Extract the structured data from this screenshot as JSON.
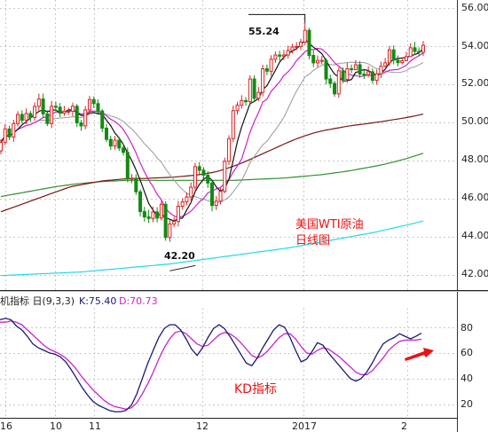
{
  "colors": {
    "up": "#dd2222",
    "down": "#138a13",
    "ma5": "#111111",
    "ma10": "#cc22cc",
    "ma20": "#999999",
    "ma60": "#7a1414",
    "ma120": "#2f8f2f",
    "ma250": "#22d8e8",
    "k": "#1a1a6e",
    "d": "#cc22cc",
    "annotation": "#ee1111",
    "arrow": "#ee1111",
    "grid": "#c8c8c8"
  },
  "chart_data": [
    {
      "type": "candlestick",
      "ylim": [
        41.3,
        56.6
      ],
      "grid": true,
      "y_ticks": [
        "56.00",
        "54.00",
        "52.00",
        "50.00",
        "48.00",
        "46.00",
        "44.00",
        "42.00"
      ],
      "x_ticks": [
        "16",
        "10",
        "11",
        "12",
        "2017",
        "2"
      ],
      "annotation": [
        "美国WTI原油",
        "日线图"
      ],
      "high_label": "55.24",
      "low_label": "42.20",
      "high_value": 55.24,
      "low_value": 42.2,
      "open": [
        48.5,
        48.95,
        49.65,
        49.23,
        49.93,
        50.41,
        50.1,
        50.46,
        50.25,
        50.83,
        51.22,
        50.44,
        49.93,
        50.84,
        50.79,
        50.48,
        50.58,
        50.58,
        50.84,
        49.97,
        49.81,
        50.65,
        51.19,
        50.98,
        50.59,
        49.69,
        49.1,
        48.75,
        49.06,
        48.65,
        48.42,
        47.02,
        47.06,
        46.35,
        45.31,
        45.03,
        44.95,
        45.29,
        44.97,
        45.69,
        43.95,
        44.66,
        44.79,
        45.59,
        45.82,
        46.08,
        46.59,
        47.67,
        47.48,
        47.22,
        46.81,
        45.63,
        45.86,
        46.37,
        47.95,
        49.14,
        50.61,
        50.9,
        51.14,
        51.08,
        52.27,
        51.26,
        51.57,
        52.81,
        52.68,
        53.31,
        53.53,
        53.47,
        53.53,
        53.77,
        53.95,
        53.98,
        54.21,
        54.83,
        53.51,
        53.12,
        53.24,
        53.25,
        52.27,
        52.04,
        51.49,
        52.7,
        52.25,
        52.81,
        52.76,
        53.02,
        52.53,
        52.5,
        52.65,
        52.2,
        52.54,
        52.94,
        53.12,
        53.8,
        53.26,
        53.13,
        53.23,
        53.45,
        53.91,
        53.72,
        53.68
      ],
      "close": [
        48.95,
        49.65,
        49.23,
        49.93,
        50.41,
        50.1,
        50.46,
        50.25,
        50.83,
        51.22,
        50.44,
        49.93,
        50.84,
        50.79,
        50.48,
        50.58,
        50.58,
        50.84,
        49.97,
        49.81,
        50.65,
        51.19,
        50.98,
        50.59,
        49.69,
        49.1,
        48.75,
        49.06,
        48.65,
        48.42,
        47.02,
        47.06,
        46.35,
        45.31,
        45.03,
        44.95,
        45.29,
        44.97,
        45.69,
        43.95,
        44.66,
        44.79,
        45.59,
        45.82,
        46.08,
        46.59,
        47.67,
        47.48,
        47.22,
        46.81,
        45.63,
        45.86,
        46.37,
        47.95,
        49.14,
        50.61,
        50.9,
        51.14,
        51.08,
        52.27,
        51.26,
        51.57,
        52.81,
        52.68,
        53.31,
        53.53,
        53.47,
        53.53,
        53.77,
        53.95,
        53.98,
        54.21,
        54.83,
        53.51,
        53.12,
        53.24,
        53.25,
        52.27,
        52.04,
        51.49,
        52.7,
        52.25,
        52.81,
        52.76,
        53.02,
        52.53,
        52.5,
        52.65,
        52.2,
        52.54,
        52.94,
        53.12,
        53.8,
        53.26,
        53.13,
        53.23,
        53.45,
        53.91,
        53.72,
        53.68,
        54.04
      ],
      "high": [
        49.12,
        49.9,
        49.82,
        50.13,
        50.58,
        50.63,
        50.72,
        50.6,
        51.04,
        51.5,
        51.51,
        50.63,
        51.12,
        51.09,
        51.01,
        50.86,
        50.77,
        51.03,
        50.96,
        50.13,
        50.85,
        51.38,
        51.36,
        51.2,
        50.69,
        49.9,
        49.3,
        49.28,
        49.23,
        48.89,
        48.67,
        47.28,
        47.26,
        46.48,
        45.56,
        45.41,
        45.57,
        45.54,
        45.88,
        45.85,
        44.88,
        45.02,
        45.87,
        46.01,
        46.32,
        46.84,
        47.87,
        47.91,
        47.64,
        47.43,
        46.97,
        46.13,
        46.54,
        48.14,
        49.32,
        50.87,
        51.08,
        51.42,
        51.32,
        52.47,
        52.47,
        51.85,
        53.02,
        53.03,
        53.52,
        53.72,
        53.75,
        53.8,
        54.02,
        54.12,
        54.21,
        54.38,
        55.24,
        54.95,
        53.77,
        53.51,
        53.48,
        53.36,
        52.5,
        52.18,
        52.89,
        52.88,
        53.12,
        53.03,
        53.27,
        53.21,
        52.76,
        52.95,
        52.83,
        52.77,
        53.18,
        53.38,
        54.01,
        54.04,
        53.51,
        53.4,
        53.7,
        54.15,
        54.22,
        53.93,
        54.27
      ],
      "low": [
        48.32,
        48.8,
        49.06,
        48.97,
        49.77,
        49.93,
        49.9,
        50.0,
        50.08,
        50.61,
        50.26,
        49.8,
        49.69,
        50.59,
        50.27,
        50.32,
        50.39,
        50.32,
        49.75,
        49.55,
        49.63,
        50.5,
        50.75,
        50.43,
        49.48,
        48.96,
        48.55,
        48.56,
        48.49,
        48.26,
        46.85,
        46.8,
        46.19,
        45.05,
        44.77,
        44.71,
        44.75,
        44.74,
        44.84,
        43.78,
        43.72,
        44.49,
        44.53,
        45.41,
        45.64,
        45.89,
        46.36,
        47.27,
        47.06,
        46.55,
        45.33,
        45.39,
        45.69,
        46.27,
        47.76,
        48.97,
        50.4,
        50.72,
        50.87,
        50.89,
        51.09,
        51.1,
        51.36,
        52.48,
        52.44,
        53.12,
        53.21,
        53.26,
        53.35,
        53.62,
        53.79,
        53.79,
        54.06,
        53.31,
        52.9,
        52.89,
        53.04,
        51.99,
        51.8,
        51.33,
        51.29,
        52.05,
        52.07,
        52.58,
        52.82,
        52.34,
        52.27,
        52.36,
        52.02,
        51.97,
        52.32,
        52.88,
        52.95,
        53.04,
        52.93,
        53.04,
        53.27,
        53.63,
        53.54,
        53.47,
        53.49
      ],
      "ma5": [
        48.95,
        49.3,
        49.28,
        49.44,
        49.63,
        49.86,
        50.03,
        50.23,
        50.41,
        50.57,
        50.66,
        50.54,
        50.65,
        50.64,
        50.5,
        50.52,
        50.65,
        50.65,
        50.49,
        50.36,
        50.37,
        50.49,
        50.52,
        50.44,
        50.42,
        50.11,
        49.82,
        49.44,
        49.17,
        48.84,
        48.38,
        47.98,
        47.5,
        46.95,
        46.35,
        45.74,
        45.39,
        45.11,
        45.19,
        44.97,
        44.91,
        44.81,
        44.94,
        44.97,
        45.39,
        45.78,
        46.36,
        46.73,
        47.01,
        47.15,
        46.96,
        46.6,
        46.38,
        46.52,
        47.0,
        47.99,
        49.0,
        49.75,
        50.38,
        50.98,
        51.09,
        51.26,
        51.71,
        51.92,
        52.33,
        52.72,
        53.16,
        53.41,
        53.61,
        53.73,
        53.86,
        54.06,
        54.33,
        54.15,
        53.94,
        53.79,
        53.59,
        53.25,
        52.85,
        52.53,
        52.37,
        52.17,
        52.18,
        52.24,
        52.61,
        52.69,
        52.77,
        52.71,
        52.58,
        52.45,
        52.56,
        52.79,
        53.12,
        53.3,
        53.35,
        53.38,
        53.39,
        53.49,
        53.55,
        53.64,
        53.89
      ],
      "ma10": [
        48.95,
        49.3,
        49.28,
        49.44,
        49.63,
        49.72,
        49.83,
        49.88,
        49.99,
        50.1,
        50.25,
        50.28,
        50.44,
        50.53,
        50.54,
        50.56,
        50.57,
        50.62,
        50.53,
        50.43,
        50.45,
        50.58,
        50.59,
        50.57,
        50.49,
        50.34,
        50.16,
        50.04,
        49.86,
        49.62,
        49.26,
        48.85,
        48.39,
        47.86,
        47.4,
        46.97,
        46.63,
        46.22,
        45.93,
        45.48,
        45.24,
        45.08,
        45.01,
        45.06,
        45.17,
        45.33,
        45.57,
        45.82,
        46.0,
        46.29,
        46.39,
        46.5,
        46.58,
        46.79,
        46.98,
        47.38,
        47.71,
        48.07,
        48.77,
        49.48,
        50.04,
        50.51,
        51.06,
        51.22,
        51.62,
        51.87,
        52.13,
        52.45,
        52.65,
        52.9,
        53.24,
        53.47,
        53.7,
        53.83,
        53.81,
        53.88,
        53.84,
        53.65,
        53.41,
        53.12,
        52.95,
        52.75,
        52.55,
        52.48,
        52.45,
        52.4,
        52.43,
        52.49,
        52.44,
        52.53,
        52.55,
        52.63,
        52.73,
        52.76,
        52.77,
        52.88,
        52.99,
        53.22,
        53.37,
        53.49,
        53.64
      ],
      "ma20": [
        48.95,
        49.3,
        49.28,
        49.44,
        49.63,
        49.72,
        49.83,
        49.88,
        49.99,
        50.1,
        50.11,
        50.09,
        50.15,
        50.2,
        50.22,
        50.24,
        50.26,
        50.29,
        50.27,
        50.25,
        50.33,
        50.4,
        50.47,
        50.51,
        50.48,
        50.42,
        50.33,
        50.27,
        50.17,
        50.04,
        49.83,
        49.64,
        49.41,
        49.14,
        48.87,
        48.64,
        48.41,
        48.13,
        47.9,
        47.55,
        47.25,
        46.96,
        46.7,
        46.46,
        46.28,
        46.15,
        46.1,
        46.02,
        45.96,
        45.89,
        45.82,
        45.79,
        45.8,
        45.93,
        46.07,
        46.35,
        46.64,
        46.95,
        47.39,
        47.88,
        48.21,
        48.51,
        48.82,
        49.0,
        49.31,
        49.6,
        49.92,
        50.26,
        50.72,
        51.19,
        51.64,
        52.0,
        52.38,
        52.52,
        52.72,
        52.87,
        52.99,
        53.05,
        53.03,
        53.01,
        53.1,
        53.11,
        53.13,
        53.16,
        53.13,
        53.14,
        53.13,
        53.07,
        52.92,
        52.82,
        52.75,
        52.69,
        52.64,
        52.62,
        52.61,
        52.64,
        52.71,
        52.86,
        52.91,
        53.01,
        53.14
      ],
      "ma60": [
        45.3,
        45.38,
        45.46,
        45.54,
        45.62,
        45.7,
        45.78,
        45.86,
        45.94,
        46.02,
        46.1,
        46.18,
        46.26,
        46.34,
        46.42,
        46.5,
        46.58,
        46.64,
        46.68,
        46.72,
        46.76,
        46.8,
        46.84,
        46.88,
        46.92,
        46.94,
        46.96,
        46.98,
        47.0,
        47.02,
        47.04,
        47.05,
        47.05,
        47.05,
        47.05,
        47.06,
        47.07,
        47.08,
        47.09,
        47.1,
        47.11,
        47.12,
        47.14,
        47.16,
        47.18,
        47.2,
        47.22,
        47.25,
        47.28,
        47.32,
        47.36,
        47.41,
        47.47,
        47.54,
        47.61,
        47.69,
        47.77,
        47.86,
        47.95,
        48.05,
        48.15,
        48.25,
        48.35,
        48.45,
        48.55,
        48.65,
        48.75,
        48.85,
        48.95,
        49.04,
        49.13,
        49.21,
        49.29,
        49.36,
        49.43,
        49.49,
        49.54,
        49.59,
        49.63,
        49.67,
        49.71,
        49.75,
        49.79,
        49.82,
        49.85,
        49.88,
        49.91,
        49.94,
        49.97,
        50.0,
        50.03,
        50.06,
        50.1,
        50.14,
        50.17,
        50.21,
        50.25,
        50.29,
        50.33,
        50.38,
        50.43
      ],
      "ma120": [
        46.1,
        46.14,
        46.18,
        46.22,
        46.26,
        46.3,
        46.34,
        46.38,
        46.42,
        46.46,
        46.5,
        46.54,
        46.58,
        46.62,
        46.65,
        46.68,
        46.71,
        46.74,
        46.77,
        46.79,
        46.81,
        46.83,
        46.85,
        46.87,
        46.89,
        46.9,
        46.91,
        46.92,
        46.93,
        46.94,
        46.95,
        46.95,
        46.95,
        46.95,
        46.95,
        46.95,
        46.95,
        46.95,
        46.95,
        46.95,
        46.95,
        46.95,
        46.95,
        46.95,
        46.95,
        46.95,
        46.95,
        46.95,
        46.95,
        46.95,
        46.95,
        46.95,
        46.95,
        46.95,
        46.95,
        46.95,
        46.96,
        46.97,
        46.98,
        46.99,
        47.0,
        47.01,
        47.02,
        47.03,
        47.04,
        47.05,
        47.06,
        47.07,
        47.09,
        47.11,
        47.13,
        47.15,
        47.17,
        47.19,
        47.21,
        47.23,
        47.25,
        47.28,
        47.31,
        47.34,
        47.37,
        47.4,
        47.43,
        47.47,
        47.51,
        47.55,
        47.59,
        47.63,
        47.67,
        47.71,
        47.76,
        47.81,
        47.86,
        47.91,
        47.97,
        48.03,
        48.09,
        48.16,
        48.23,
        48.3,
        48.37
      ],
      "ma250": [
        41.95,
        41.96,
        41.97,
        41.98,
        41.99,
        42.0,
        42.01,
        42.02,
        42.03,
        42.04,
        42.05,
        42.06,
        42.07,
        42.08,
        42.09,
        42.1,
        42.11,
        42.12,
        42.13,
        42.14,
        42.16,
        42.18,
        42.2,
        42.22,
        42.24,
        42.26,
        42.28,
        42.3,
        42.32,
        42.34,
        42.36,
        42.38,
        42.4,
        42.42,
        42.44,
        42.46,
        42.48,
        42.5,
        42.52,
        42.54,
        42.56,
        42.59,
        42.62,
        42.65,
        42.68,
        42.71,
        42.74,
        42.77,
        42.8,
        42.83,
        42.86,
        42.89,
        42.92,
        42.95,
        42.98,
        43.01,
        43.04,
        43.07,
        43.1,
        43.13,
        43.16,
        43.19,
        43.22,
        43.25,
        43.28,
        43.31,
        43.34,
        43.37,
        43.4,
        43.44,
        43.48,
        43.52,
        43.56,
        43.6,
        43.64,
        43.68,
        43.72,
        43.76,
        43.8,
        43.84,
        43.88,
        43.92,
        43.96,
        44.0,
        44.04,
        44.08,
        44.12,
        44.16,
        44.2,
        44.25,
        44.3,
        44.35,
        44.4,
        44.45,
        44.5,
        44.55,
        44.6,
        44.65,
        44.7,
        44.76,
        44.82
      ]
    },
    {
      "type": "line",
      "title": "机指标 日(9,3,3)",
      "k_label": "K:75.40",
      "d_label": "D:70.73",
      "ylim": [
        10,
        92
      ],
      "y_ticks": [
        "80",
        "60",
        "40",
        "20"
      ],
      "annotation": "KD指标",
      "series": [
        {
          "name": "K",
          "values": [
            86,
            87,
            86,
            81,
            78,
            73,
            67,
            64,
            62,
            60,
            59,
            57,
            53,
            47,
            40,
            33,
            27,
            22,
            19,
            17,
            15,
            14,
            14,
            15,
            19,
            28,
            40,
            52,
            62,
            72,
            79,
            82,
            82,
            78,
            71,
            63,
            58,
            64,
            72,
            79,
            82,
            79,
            73,
            66,
            59,
            52,
            50,
            56,
            64,
            71,
            78,
            82,
            80,
            72,
            62,
            53,
            55,
            61,
            68,
            66,
            60,
            55,
            50,
            45,
            40,
            38,
            40,
            45,
            52,
            60,
            67,
            70,
            72,
            75,
            73,
            71,
            73,
            75.4
          ]
        },
        {
          "name": "D",
          "values": [
            84,
            84,
            85,
            84,
            82,
            78,
            74,
            70,
            66,
            63,
            61,
            59,
            56,
            52,
            47,
            41,
            36,
            31,
            27,
            23,
            20,
            18,
            17,
            16,
            17,
            21,
            28,
            36,
            45,
            55,
            64,
            71,
            76,
            77,
            75,
            71,
            67,
            65,
            66,
            70,
            74,
            76,
            75,
            72,
            68,
            63,
            58,
            56,
            58,
            62,
            67,
            72,
            75,
            75,
            71,
            65,
            60,
            59,
            62,
            64,
            63,
            60,
            57,
            53,
            49,
            45,
            43,
            43,
            46,
            51,
            56,
            62,
            66,
            69,
            70,
            70,
            70,
            70.73
          ]
        }
      ]
    }
  ]
}
